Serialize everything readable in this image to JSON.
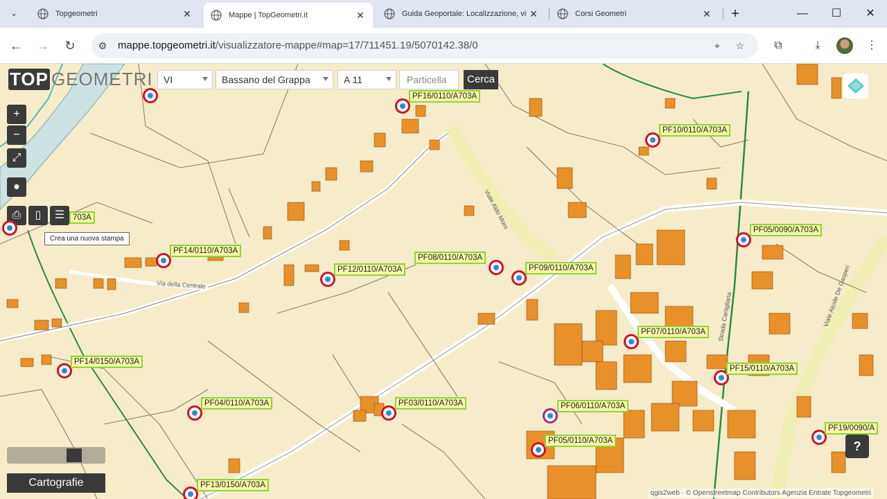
{
  "browser": {
    "tabs": [
      {
        "title": "Topgeometri",
        "active": false
      },
      {
        "title": "Mappe | TopGeometri.it",
        "active": true
      },
      {
        "title": "Guida Geoportale: Localizzazione, visuali",
        "active": false
      },
      {
        "title": "Corsi Geometri",
        "active": false
      }
    ],
    "url_domain": "mappe.topgeometri.it",
    "url_path": "/visualizzatore-mappe#map=17/711451.19/5070142.38/0"
  },
  "app": {
    "logo_top": "TOP",
    "logo_geo": "GEOMETRI",
    "province": "VI",
    "comune": "Bassano del Grappa",
    "foglio": "A 11",
    "particella_placeholder": "Particella",
    "search_label": "Cerca",
    "tooltip": "Crea una nuova stampa",
    "cartografie_label": "Cartografie",
    "help_label": "?",
    "attribution": "qgis2web · © Openstreetmap Contributors Agenzia Entrate Topgeometri"
  },
  "map": {
    "points": [
      "PF16/0110/A703A",
      "PF10/0110/A703A",
      "PF05/0090/A703A",
      "PF14/0110/A703A",
      "PF12/0110/A703A",
      "PF08/0110/A703A",
      "PF09/0110/A703A",
      "PF07/0110/A703A",
      "PF14/0150/A703A",
      "PF15/0110/A703A",
      "PF04/0110/A703A",
      "PF03/0110/A703A",
      "PF06/0110/A703A",
      "PF05/0110/A703A",
      "PF19/0090/A",
      "PF13/0150/A703A",
      "703A"
    ],
    "street_labels": [
      "Via della Centrale",
      "Viale Aldo Moro",
      "Viale Alcide De Gasperi",
      "Strada Cartigliana"
    ]
  },
  "colors": {
    "map_bg": "#f6ecc9",
    "building": "#e8902a",
    "pin_ring": "#d0102a",
    "pin_dot": "#2e8bd0",
    "label_bg": "#f7f7a8",
    "label_border": "#8fd43a",
    "control_bg": "#3a3a3a"
  }
}
